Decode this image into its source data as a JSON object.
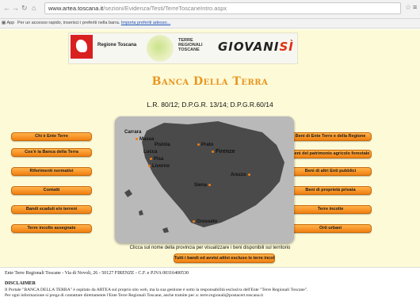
{
  "browser": {
    "url_domain": "www.artea.toscana.it",
    "url_path": "/sezioni/Evidenza/Testi/TerreToscaneIntro.aspx",
    "apps_label": "App",
    "bookmark_message": "Per un accesso rapido, inserisci i preferiti nella barra.",
    "bookmark_link": "Importa preferiti adesso..."
  },
  "header": {
    "region_label": "Regione Toscana",
    "terre_label_1": "TERRE",
    "terre_label_2": "REGIONALI",
    "terre_label_3": "TOSCANE",
    "giovani_main": "GIOVANI",
    "giovani_accent": "SÌ"
  },
  "main": {
    "title": "Banca Della Terra",
    "law": "L.R. 80/12; D.P.G.R. 13/14; D.P.G.R.60/14",
    "left_buttons": [
      "Chi è Ente Terre",
      "Cos'è la Banca della Terra",
      "Riferimenti normativi",
      "Contatti",
      "Bandi scaduti e/o terreni",
      "Terre incolte assegnate"
    ],
    "right_buttons": [
      "Beni di Ente Terre e della Regione",
      "Beni del patrimonio agricolo forestale",
      "Beni di altri Enti pubblici",
      "Beni di proprietà privata",
      "Terre incolte",
      "Orti urbani"
    ],
    "map_caption": "Clicca sul nome della provincia per visualizzare i beni disponibili sul territorio",
    "all_button": "Tutti i bandi ed avvisi attivi escluso le terre incolte",
    "cities": {
      "carrara": "Carrara",
      "massa": "Massa",
      "pistoia": "Pistoia",
      "prato": "Prato",
      "lucca": "Lucca",
      "firenze": "Firenze",
      "pisa": "Pisa",
      "livorno": "Livorno",
      "arezzo": "Arezzo",
      "siena": "Siena",
      "grosseto": "Grosseto"
    }
  },
  "footer": {
    "address": "Ente Terre Regionali Toscane - Via di Novoli, 26 - 50127 FIRENZE - C.F. e P.IVA 00316400530",
    "disclaimer_title": "DISCLAIMER",
    "disclaimer_1": "Il Portale \"BANCA DELLA TERRA\" è ospitato da ARTEA sul proprio sito web, ma la sua gestione è sotto la responsabilità esclusiva dell'Ente \"Terre Regionali Toscane\".",
    "disclaimer_2": "Per ogni informazione si prega di contattare direttamente l'Ente Terre Regionali Toscane, anche tramite pec a: terre.regionali@postacert.toscana.it"
  },
  "colors": {
    "accent": "#e8961e",
    "button": "#f07f10",
    "page_bg": "#fdfad8"
  }
}
